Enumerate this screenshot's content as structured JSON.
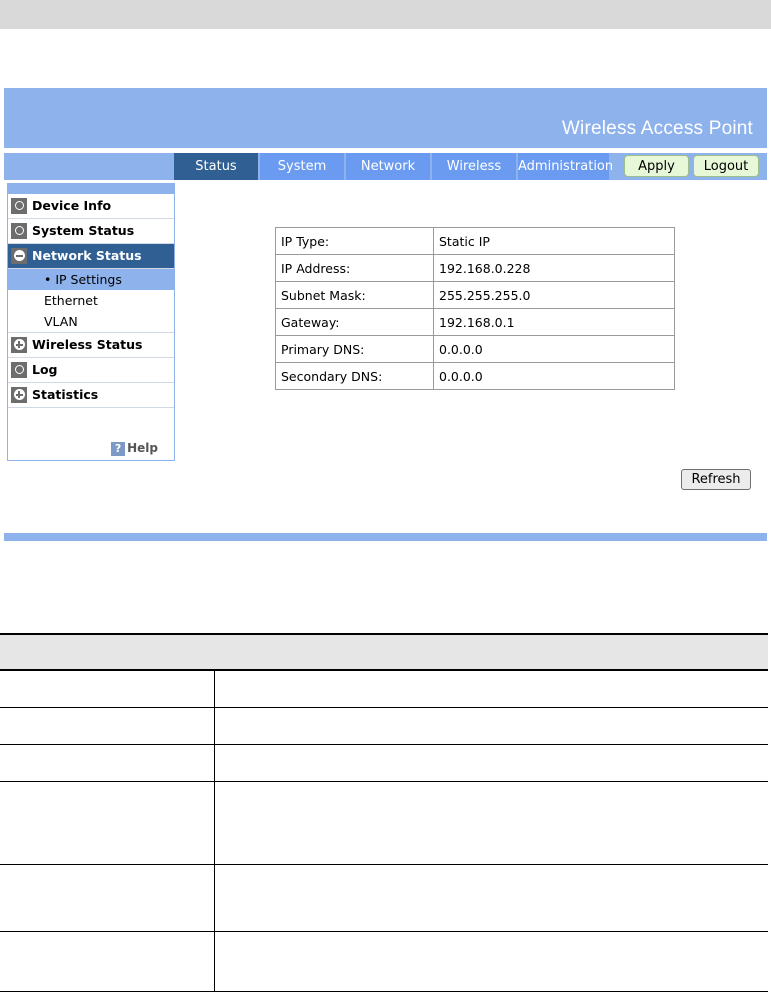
{
  "banner": {
    "title": "Wireless Access Point"
  },
  "tabs": [
    {
      "label": "Status",
      "active": true
    },
    {
      "label": "System",
      "active": false
    },
    {
      "label": "Network",
      "active": false
    },
    {
      "label": "Wireless",
      "active": false
    },
    {
      "label": "Administration",
      "active": false
    }
  ],
  "toolbar": {
    "apply_label": "Apply",
    "logout_label": "Logout"
  },
  "sidebar": {
    "items": [
      {
        "label": "Device Info",
        "icon": "circle-icon"
      },
      {
        "label": "System Status",
        "icon": "circle-icon"
      },
      {
        "label": "Network Status",
        "icon": "minus-icon",
        "active": true
      },
      {
        "label": "Wireless Status",
        "icon": "plus-icon"
      },
      {
        "label": "Log",
        "icon": "circle-icon"
      },
      {
        "label": "Statistics",
        "icon": "plus-icon"
      }
    ],
    "subitems": [
      {
        "label": "IP Settings",
        "selected": true
      },
      {
        "label": "Ethernet"
      },
      {
        "label": "VLAN"
      }
    ],
    "help_label": "Help"
  },
  "ip_settings": {
    "rows": [
      {
        "label": "IP Type:",
        "value": "Static IP"
      },
      {
        "label": "IP Address:",
        "value": "192.168.0.228"
      },
      {
        "label": "Subnet Mask:",
        "value": "255.255.255.0"
      },
      {
        "label": "Gateway:",
        "value": "192.168.0.1"
      },
      {
        "label": "Primary DNS:",
        "value": "0.0.0.0"
      },
      {
        "label": "Secondary DNS:",
        "value": "0.0.0.0"
      }
    ]
  },
  "refresh_label": "Refresh",
  "colors": {
    "banner": "#8eb2ec",
    "tab": "#6b9bf0",
    "tab_active": "#2f5f93",
    "button_bg": "#e7f8d8"
  }
}
